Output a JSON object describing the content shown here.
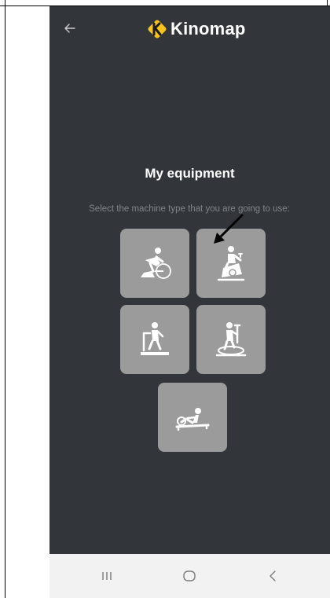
{
  "app": {
    "logo_text": "Kinomap"
  },
  "header": {
    "back_icon": "arrow-left-icon"
  },
  "main": {
    "title": "My equipment",
    "subtitle": "Select the machine type that you are going to use:",
    "machines": [
      {
        "icon": "road-bike-trainer-icon"
      },
      {
        "icon": "exercise-bike-icon"
      },
      {
        "icon": "treadmill-icon"
      },
      {
        "icon": "elliptical-trainer-icon"
      },
      {
        "icon": "rowing-machine-icon"
      }
    ]
  },
  "navbar": {
    "recent_icon": "recent-apps-icon",
    "home_icon": "home-icon",
    "back_icon": "back-icon"
  },
  "colors": {
    "background": "#32363a",
    "tile": "#9b9b9b",
    "brand_yellow": "#f6c21c",
    "subtitle": "#7f858a",
    "navbar": "#f2f2f2"
  }
}
